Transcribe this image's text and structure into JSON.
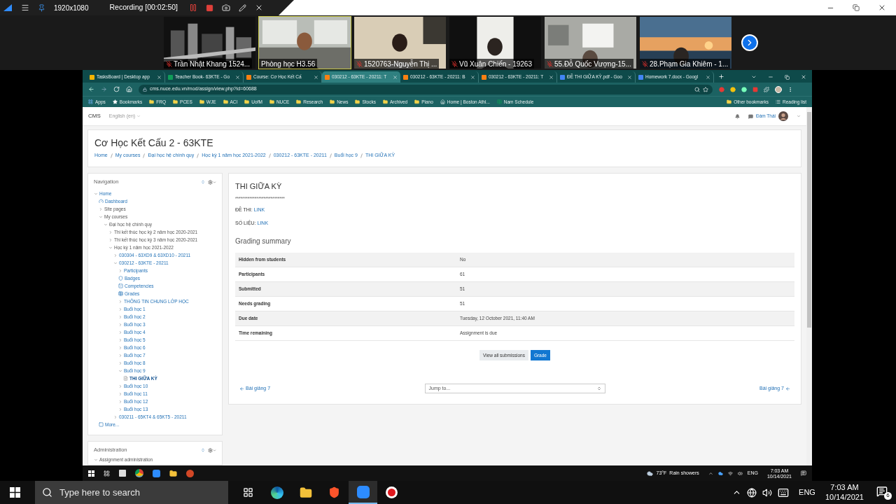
{
  "recorder": {
    "resolution": "1920x1080",
    "status": "Recording [00:02:50]"
  },
  "participants": [
    {
      "name": "Trần Nhật Khang 1524...",
      "muted": true,
      "speaking": false
    },
    {
      "name": "Phòng học H3.56",
      "muted": false,
      "speaking": true
    },
    {
      "name": "1520763-Nguyễn Thị ...",
      "muted": true,
      "speaking": false
    },
    {
      "name": "Vũ Xuân Chiến - 19263",
      "muted": true,
      "speaking": false
    },
    {
      "name": "55.Đỗ Quốc Vượng-15...",
      "muted": true,
      "speaking": false
    },
    {
      "name": "28.Phạm Gia Khiêm - 1...",
      "muted": true,
      "speaking": false
    }
  ],
  "browser": {
    "tabs": [
      {
        "label": "TasksBoard | Desktop app",
        "kind": "tasks",
        "selected": false
      },
      {
        "label": "Teacher Book- 63KTE - Go",
        "kind": "sheets",
        "selected": false
      },
      {
        "label": "Course: Cơ Học Kết Cấ",
        "kind": "moodle",
        "selected": false
      },
      {
        "label": "030212 - 63KTE - 20211: T",
        "kind": "moodle",
        "selected": true
      },
      {
        "label": "030212 - 63KTE - 20211: B",
        "kind": "moodle",
        "selected": false
      },
      {
        "label": "030212 - 63KTE - 20211: T",
        "kind": "moodle",
        "selected": false
      },
      {
        "label": "ĐỀ THI GIỮA KỲ.pdf - Goo",
        "kind": "drive",
        "selected": false
      },
      {
        "label": "Homework 7.docx - Googl",
        "kind": "docs",
        "selected": false
      }
    ],
    "url": "cms.nuce.edu.vn/mod/assign/view.php?id=60688",
    "bookmarks": [
      {
        "label": "Apps",
        "kind": "apps"
      },
      {
        "label": "Bookmarks",
        "kind": "star"
      },
      {
        "label": "FRQ",
        "kind": "folder"
      },
      {
        "label": "PCES",
        "kind": "folder"
      },
      {
        "label": "WJE",
        "kind": "folder"
      },
      {
        "label": "ACI",
        "kind": "folder"
      },
      {
        "label": "UofM",
        "kind": "folder"
      },
      {
        "label": "NUCE",
        "kind": "folder"
      },
      {
        "label": "Research",
        "kind": "folder"
      },
      {
        "label": "News",
        "kind": "folder"
      },
      {
        "label": "Stocks",
        "kind": "folder"
      },
      {
        "label": "Archived",
        "kind": "folder"
      },
      {
        "label": "Piano",
        "kind": "folder"
      },
      {
        "label": "Home | Boston Athl...",
        "kind": "site"
      },
      {
        "label": "Nam Schedule",
        "kind": "sheets"
      }
    ],
    "bookmarks_right": [
      {
        "label": "Other bookmarks",
        "kind": "folder"
      },
      {
        "label": "Reading list",
        "kind": "list"
      }
    ]
  },
  "site": {
    "brand": "CMS",
    "language": "English (en)",
    "user": "Đàm Thái"
  },
  "course_title": "Cơ Học Kết Cấu 2 - 63KTE",
  "breadcrumbs": [
    "Home",
    "My courses",
    "Đại học hệ chính quy",
    "Học kỳ 1 năm học 2021-2022",
    "030212 - 63KTE - 20211",
    "Buổi học 9",
    "THI GIỮA KỲ"
  ],
  "navigation": {
    "title": "Navigation",
    "tree": [
      {
        "label": "Home",
        "kind": "branch",
        "link": true,
        "selected": false,
        "expanded": true,
        "children": [
          {
            "label": "Dashboard",
            "kind": "dashboard",
            "link": true,
            "selected": false
          },
          {
            "label": "Site pages",
            "kind": "branch",
            "link": false,
            "selected": false,
            "expanded": false
          },
          {
            "label": "My courses",
            "kind": "branch",
            "link": false,
            "selected": false,
            "expanded": true,
            "children": [
              {
                "label": "Đại học hệ chính quy",
                "kind": "branch",
                "link": false,
                "selected": false,
                "expanded": true,
                "children": [
                  {
                    "label": "Thi kết thúc học kỳ 2 năm học 2020-2021",
                    "kind": "branch",
                    "link": false,
                    "selected": false,
                    "expanded": false
                  },
                  {
                    "label": "Thi kết thúc học kỳ 3 năm học 2020-2021",
                    "kind": "branch",
                    "link": false,
                    "selected": false,
                    "expanded": false
                  },
                  {
                    "label": "Học kỳ 1 năm học 2021-2022",
                    "kind": "branch",
                    "link": false,
                    "selected": false,
                    "expanded": true,
                    "children": [
                      {
                        "label": "030304 - 63XD9 & 63XD10 - 20211",
                        "kind": "branch",
                        "link": true,
                        "selected": false,
                        "expanded": false
                      },
                      {
                        "label": "030212 - 63KTE - 20211",
                        "kind": "branch",
                        "link": true,
                        "selected": false,
                        "expanded": true,
                        "children": [
                          {
                            "label": "Participants",
                            "kind": "branch",
                            "link": true,
                            "selected": false,
                            "expanded": false
                          },
                          {
                            "label": "Badges",
                            "kind": "badges",
                            "link": true,
                            "selected": false
                          },
                          {
                            "label": "Competencies",
                            "kind": "competencies",
                            "link": true,
                            "selected": false
                          },
                          {
                            "label": "Grades",
                            "kind": "grades",
                            "link": true,
                            "selected": false
                          },
                          {
                            "label": "THÔNG TIN CHUNG LỚP HỌC",
                            "kind": "branch",
                            "link": true,
                            "selected": false,
                            "expanded": false
                          },
                          {
                            "label": "Buổi học 1",
                            "kind": "branch",
                            "link": true,
                            "selected": false,
                            "expanded": false
                          },
                          {
                            "label": "Buổi học 2",
                            "kind": "branch",
                            "link": true,
                            "selected": false,
                            "expanded": false
                          },
                          {
                            "label": "Buổi học 3",
                            "kind": "branch",
                            "link": true,
                            "selected": false,
                            "expanded": false
                          },
                          {
                            "label": "Buổi học 4",
                            "kind": "branch",
                            "link": true,
                            "selected": false,
                            "expanded": false
                          },
                          {
                            "label": "Buổi học 5",
                            "kind": "branch",
                            "link": true,
                            "selected": false,
                            "expanded": false
                          },
                          {
                            "label": "Buổi học 6",
                            "kind": "branch",
                            "link": true,
                            "selected": false,
                            "expanded": false
                          },
                          {
                            "label": "Buổi học 7",
                            "kind": "branch",
                            "link": true,
                            "selected": false,
                            "expanded": false
                          },
                          {
                            "label": "Buổi học 8",
                            "kind": "branch",
                            "link": true,
                            "selected": false,
                            "expanded": false
                          },
                          {
                            "label": "Buổi học 9",
                            "kind": "branch",
                            "link": true,
                            "selected": false,
                            "expanded": true,
                            "children": [
                              {
                                "label": "THI GIỮA KỲ",
                                "kind": "assignment",
                                "link": true,
                                "selected": true
                              }
                            ]
                          },
                          {
                            "label": "Buổi học 10",
                            "kind": "branch",
                            "link": true,
                            "selected": false,
                            "expanded": false
                          },
                          {
                            "label": "Buổi học 11",
                            "kind": "branch",
                            "link": true,
                            "selected": false,
                            "expanded": false
                          },
                          {
                            "label": "Buổi học 12",
                            "kind": "branch",
                            "link": true,
                            "selected": false,
                            "expanded": false
                          },
                          {
                            "label": "Buổi học 13",
                            "kind": "branch",
                            "link": true,
                            "selected": false,
                            "expanded": false
                          }
                        ]
                      },
                      {
                        "label": "030211 - 65KT4 & 65KT5 - 20211",
                        "kind": "branch",
                        "link": true,
                        "selected": false,
                        "expanded": false
                      }
                    ]
                  }
                ]
              }
            ]
          },
          {
            "label": "More...",
            "kind": "more",
            "link": true,
            "selected": false
          }
        ]
      }
    ]
  },
  "administration": {
    "title": "Administration",
    "items": [
      {
        "label": "Assignment administration",
        "expanded": true
      }
    ]
  },
  "assignment": {
    "title": "THI GIỮA KỲ",
    "divider_text": "****************************",
    "links": [
      {
        "label": "ĐỀ THI:",
        "link": "LINK"
      },
      {
        "label": "SỐ LIỆU:",
        "link": "LINK"
      }
    ],
    "summary_title": "Grading summary",
    "rows": [
      {
        "label": "Hidden from students",
        "value": "No"
      },
      {
        "label": "Participants",
        "value": "61"
      },
      {
        "label": "Submitted",
        "value": "51"
      },
      {
        "label": "Needs grading",
        "value": "51"
      },
      {
        "label": "Due date",
        "value": "Tuesday, 12 October 2021, 11:40 AM"
      },
      {
        "label": "Time remaining",
        "value": "Assignment is due"
      }
    ],
    "buttons": [
      {
        "label": "View all submissions",
        "kind": "secondary"
      },
      {
        "label": "Grade",
        "kind": "primary"
      }
    ],
    "prev": "Bài giảng 7",
    "jump": "Jump to...",
    "next": "Bài giảng 7"
  },
  "shared_taskbar": {
    "weather": "73°F",
    "forecast": "Rain showers",
    "language": "ENG",
    "time": "7:03 AM",
    "date": "10/14/2021"
  },
  "taskbar": {
    "search_placeholder": "Type here to search",
    "language": "ENG",
    "time": "7:03 AM",
    "date": "10/14/2021",
    "notifications": "6"
  }
}
